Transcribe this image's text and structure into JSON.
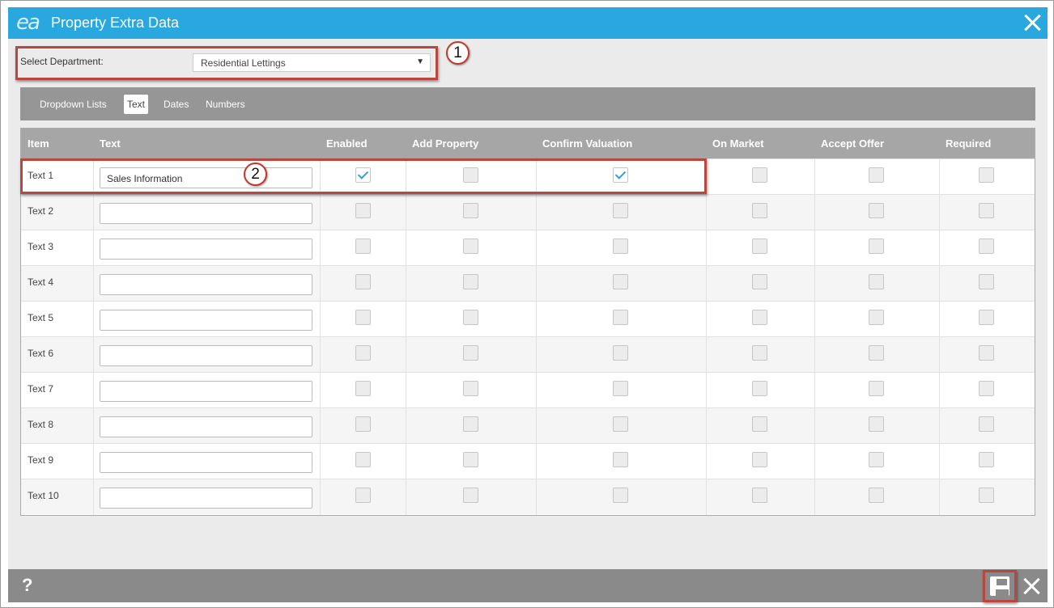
{
  "window": {
    "logo_text": "ea",
    "title": "Property Extra Data"
  },
  "department": {
    "label": "Select Department:",
    "selected": "Residential Lettings",
    "caret": "▼"
  },
  "callouts": [
    "1",
    "2"
  ],
  "tabs": [
    "Dropdown Lists",
    "Text",
    "Dates",
    "Numbers"
  ],
  "active_tab": "Text",
  "table": {
    "columns": [
      "Item",
      "Text",
      "Enabled",
      "Add Property",
      "Confirm Valuation",
      "On Market",
      "Accept Offer",
      "Required"
    ],
    "rows": [
      {
        "item": "Text 1",
        "text": "Sales Information",
        "enabled": true,
        "add_property": false,
        "confirm_valuation": true,
        "on_market": false,
        "accept_offer": false,
        "required": false
      },
      {
        "item": "Text 2",
        "text": "",
        "enabled": false,
        "add_property": false,
        "confirm_valuation": false,
        "on_market": false,
        "accept_offer": false,
        "required": false
      },
      {
        "item": "Text 3",
        "text": "",
        "enabled": false,
        "add_property": false,
        "confirm_valuation": false,
        "on_market": false,
        "accept_offer": false,
        "required": false
      },
      {
        "item": "Text 4",
        "text": "",
        "enabled": false,
        "add_property": false,
        "confirm_valuation": false,
        "on_market": false,
        "accept_offer": false,
        "required": false
      },
      {
        "item": "Text 5",
        "text": "",
        "enabled": false,
        "add_property": false,
        "confirm_valuation": false,
        "on_market": false,
        "accept_offer": false,
        "required": false
      },
      {
        "item": "Text 6",
        "text": "",
        "enabled": false,
        "add_property": false,
        "confirm_valuation": false,
        "on_market": false,
        "accept_offer": false,
        "required": false
      },
      {
        "item": "Text 7",
        "text": "",
        "enabled": false,
        "add_property": false,
        "confirm_valuation": false,
        "on_market": false,
        "accept_offer": false,
        "required": false
      },
      {
        "item": "Text 8",
        "text": "",
        "enabled": false,
        "add_property": false,
        "confirm_valuation": false,
        "on_market": false,
        "accept_offer": false,
        "required": false
      },
      {
        "item": "Text 9",
        "text": "",
        "enabled": false,
        "add_property": false,
        "confirm_valuation": false,
        "on_market": false,
        "accept_offer": false,
        "required": false
      },
      {
        "item": "Text 10",
        "text": "",
        "enabled": false,
        "add_property": false,
        "confirm_valuation": false,
        "on_market": false,
        "accept_offer": false,
        "required": false
      }
    ]
  },
  "footer": {
    "help_label": "?"
  },
  "icons": {
    "close": "close-icon",
    "save": "save-icon",
    "help": "help-icon",
    "caret": "chevron-down-icon"
  },
  "colors": {
    "titlebar": "#29a8e0",
    "callout": "#b8473f",
    "check": "#2aa3dd",
    "footer": "#8a8a8a"
  }
}
